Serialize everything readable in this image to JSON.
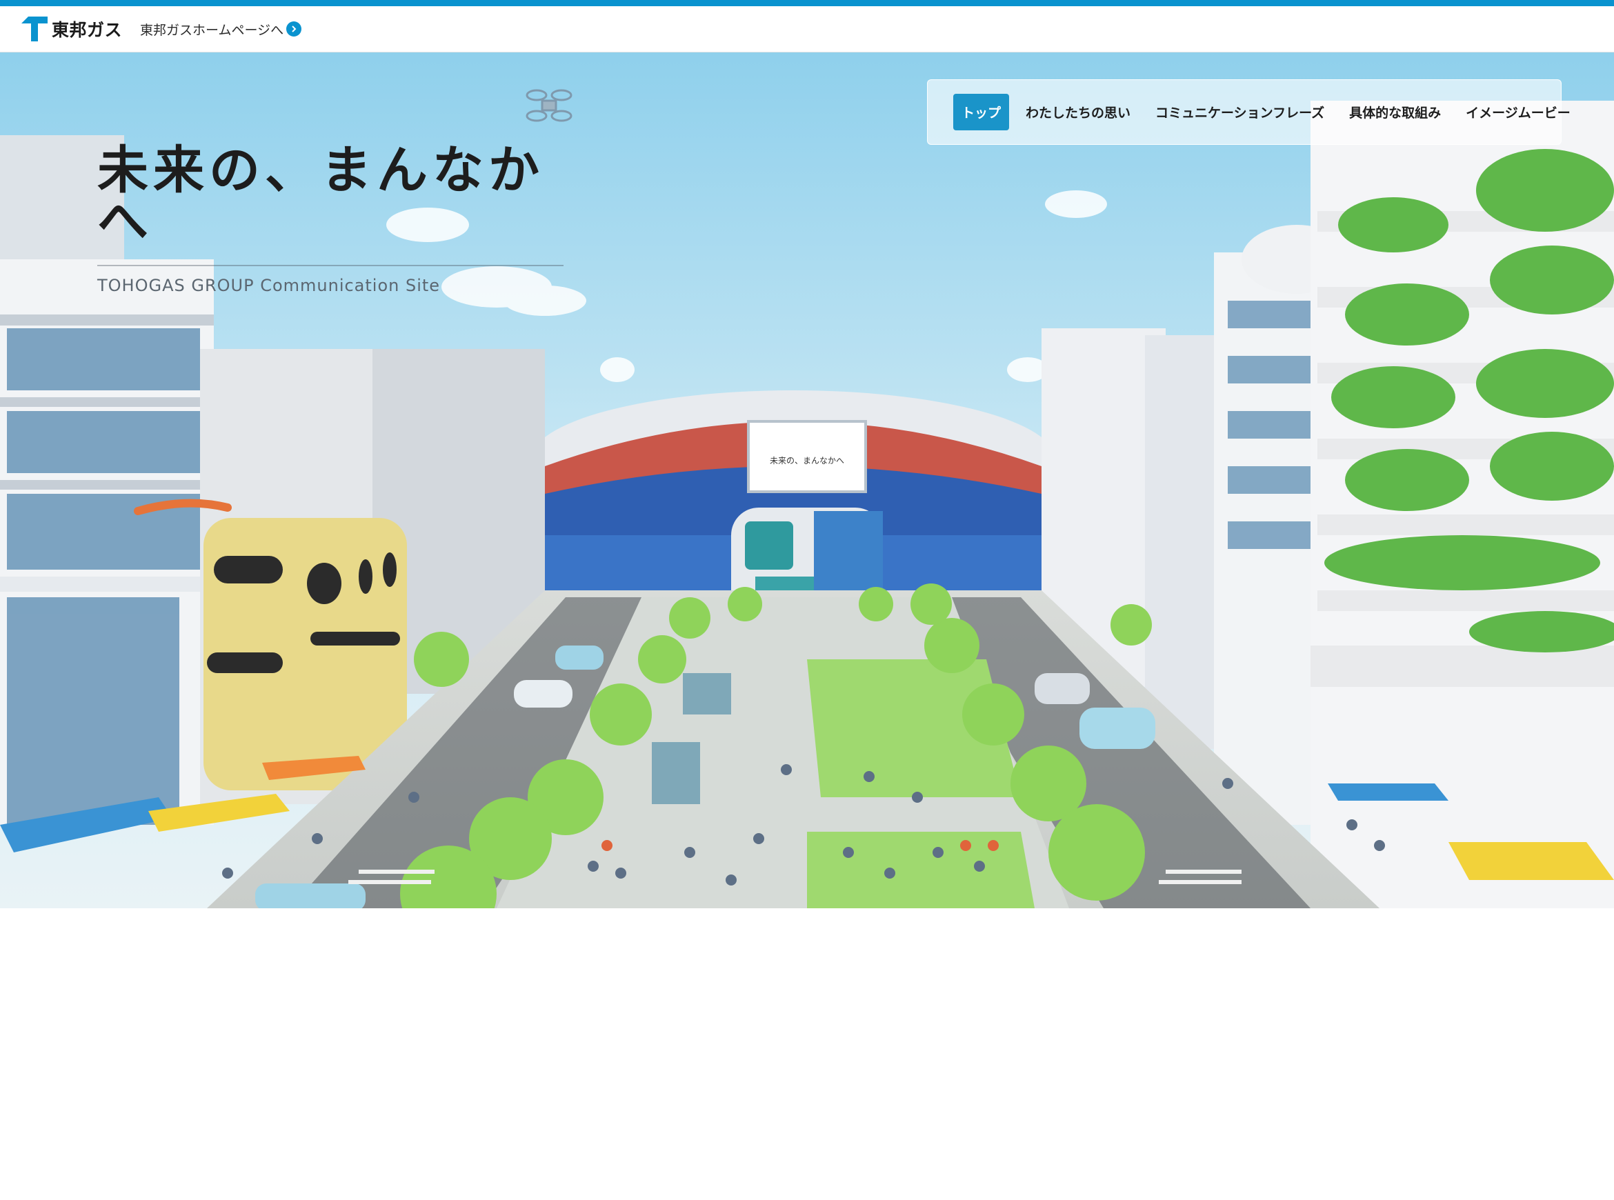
{
  "header": {
    "logo_text": "東邦ガス",
    "home_link": "東邦ガスホームページへ"
  },
  "hero": {
    "title": "未来の、まんなかへ",
    "subtitle": "TOHOGAS GROUP Communication Site",
    "screen_text": "未来の、まんなかへ"
  },
  "nav": {
    "items": [
      {
        "label": "トップ",
        "active": true
      },
      {
        "label": "わたしたちの思い"
      },
      {
        "label": "コミュニケーションフレーズ"
      },
      {
        "label": "具体的な取組み"
      },
      {
        "label": "イメージムービー"
      }
    ]
  },
  "colors": {
    "brand": "#0a93cf",
    "nav_active": "#1a94c9"
  }
}
